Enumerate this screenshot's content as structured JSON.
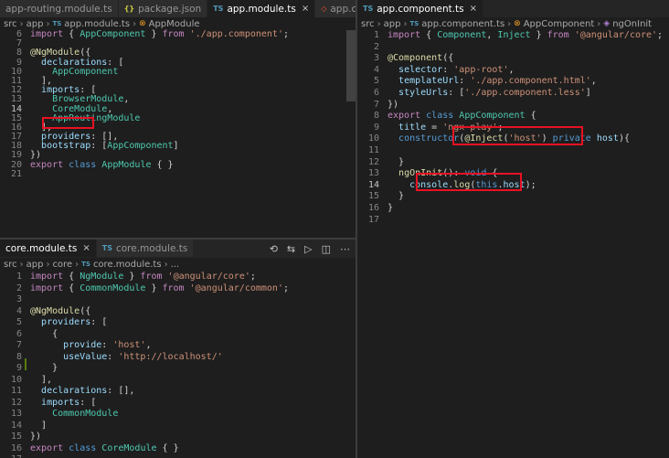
{
  "top_left": {
    "tabs": [
      {
        "icon": "",
        "label": "app-routing.module.ts",
        "active": false
      },
      {
        "icon": "{}",
        "label": "package.json",
        "active": false
      },
      {
        "icon": "TS",
        "label": "app.module.ts",
        "active": true
      },
      {
        "icon": "◇",
        "label": "app.compon",
        "active": false
      }
    ],
    "breadcrumb": [
      "src",
      "app",
      "app.module.ts",
      "AppModule"
    ],
    "lines": [
      {
        "n": "6",
        "html": "<span class='kc'>import</span> { <span class='cls'>AppComponent</span> } <span class='kc'>from</span> <span class='str'>'./app.component'</span>;"
      },
      {
        "n": "7",
        "html": ""
      },
      {
        "n": "8",
        "html": "<span class='dec'>@NgModule</span>({"
      },
      {
        "n": "9",
        "html": "  <span class='prop'>declarations</span>: ["
      },
      {
        "n": "10",
        "html": "    <span class='cls'>AppComponent</span>"
      },
      {
        "n": "11",
        "html": "  ],"
      },
      {
        "n": "12",
        "html": "  <span class='prop'>imports</span>: ["
      },
      {
        "n": "13",
        "html": "    <span class='cls'>BrowserModule</span>,"
      },
      {
        "n": "14",
        "html": "    <span class='cls'>CoreModule</span>,"
      },
      {
        "n": "15",
        "html": "    <span class='cls'>AppRoutingModule</span>"
      },
      {
        "n": "16",
        "html": "  ],"
      },
      {
        "n": "17",
        "html": "  <span class='prop'>providers</span>: [],"
      },
      {
        "n": "18",
        "html": "  <span class='prop'>bootstrap</span>: [<span class='cls'>AppComponent</span>]"
      },
      {
        "n": "19",
        "html": "})"
      },
      {
        "n": "20",
        "html": "<span class='kc'>export</span> <span class='kw'>class</span> <span class='cls'>AppModule</span> { }"
      },
      {
        "n": "21",
        "html": ""
      }
    ]
  },
  "bottom_left": {
    "tabs": [
      {
        "icon": "",
        "label": "core.module.ts",
        "active": true
      },
      {
        "icon": "TS",
        "label": "core.module.ts",
        "active": false
      }
    ],
    "breadcrumb": [
      "src",
      "app",
      "core",
      "core.module.ts",
      "..."
    ],
    "lines": [
      {
        "n": "1",
        "html": "<span class='kc'>import</span> { <span class='cls'>NgModule</span> } <span class='kc'>from</span> <span class='str'>'@angular/core'</span>;"
      },
      {
        "n": "2",
        "html": "<span class='kc'>import</span> { <span class='cls'>CommonModule</span> } <span class='kc'>from</span> <span class='str'>'@angular/common'</span>;"
      },
      {
        "n": "3",
        "html": ""
      },
      {
        "n": "4",
        "html": "<span class='dec'>@NgModule</span>({"
      },
      {
        "n": "5",
        "html": "  <span class='prop'>providers</span>: ["
      },
      {
        "n": "6",
        "html": "    {"
      },
      {
        "n": "7",
        "html": "      <span class='prop'>provide</span>: <span class='str'>'host'</span>,"
      },
      {
        "n": "8",
        "html": "      <span class='prop'>useValue</span>: <span class='str'>'http://localhost/'</span>"
      },
      {
        "n": "9",
        "html": "    }"
      },
      {
        "n": "10",
        "html": "  ],"
      },
      {
        "n": "11",
        "html": "  <span class='prop'>declarations</span>: [],"
      },
      {
        "n": "12",
        "html": "  <span class='prop'>imports</span>: ["
      },
      {
        "n": "13",
        "html": "    <span class='cls'>CommonModule</span>"
      },
      {
        "n": "14",
        "html": "  ]"
      },
      {
        "n": "15",
        "html": "})"
      },
      {
        "n": "16",
        "html": "<span class='kc'>export</span> <span class='kw'>class</span> <span class='cls'>CoreModule</span> { }"
      },
      {
        "n": "17",
        "html": ""
      }
    ]
  },
  "right": {
    "tabs": [
      {
        "icon": "TS",
        "label": "app.component.ts",
        "active": true
      }
    ],
    "breadcrumb": [
      "src",
      "app",
      "app.component.ts",
      "AppComponent",
      "ngOnInit"
    ],
    "lines": [
      {
        "n": "1",
        "html": "<span class='kc'>import</span> { <span class='cls'>Component</span>, <span class='cls'>Inject</span> } <span class='kc'>from</span> <span class='str'>'@angular/core'</span>;"
      },
      {
        "n": "2",
        "html": ""
      },
      {
        "n": "3",
        "html": "<span class='dec'>@Component</span>({"
      },
      {
        "n": "4",
        "html": "  <span class='prop'>selector</span>: <span class='str'>'app-root'</span>,"
      },
      {
        "n": "5",
        "html": "  <span class='prop'>templateUrl</span>: <span class='str'>'./app.component.html'</span>,"
      },
      {
        "n": "6",
        "html": "  <span class='prop'>styleUrls</span>: [<span class='str'>'./app.component.less'</span>]"
      },
      {
        "n": "7",
        "html": "})"
      },
      {
        "n": "8",
        "html": "<span class='kc'>export</span> <span class='kw'>class</span> <span class='cls'>AppComponent</span> {"
      },
      {
        "n": "9",
        "html": "  <span class='prop'>title</span> = <span class='str'>'ngx-play'</span>;"
      },
      {
        "n": "10",
        "html": "  <span class='kw'>constructor</span>(<span class='dec'>@Inject</span>(<span class='str'>'host'</span>) <span class='kw'>private</span> <span class='prop'>host</span>){"
      },
      {
        "n": "11",
        "html": ""
      },
      {
        "n": "12",
        "html": "  }"
      },
      {
        "n": "13",
        "html": "  <span class='fn'>ngOnInit</span>(): <span class='kw'>void</span> {"
      },
      {
        "n": "14",
        "html": "    <span class='prop'>console</span>.<span class='fn'>log</span>(<span class='kw'>this</span>.<span class='prop'>host</span>);"
      },
      {
        "n": "15",
        "html": "  }"
      },
      {
        "n": "16",
        "html": "}"
      },
      {
        "n": "17",
        "html": ""
      }
    ]
  }
}
